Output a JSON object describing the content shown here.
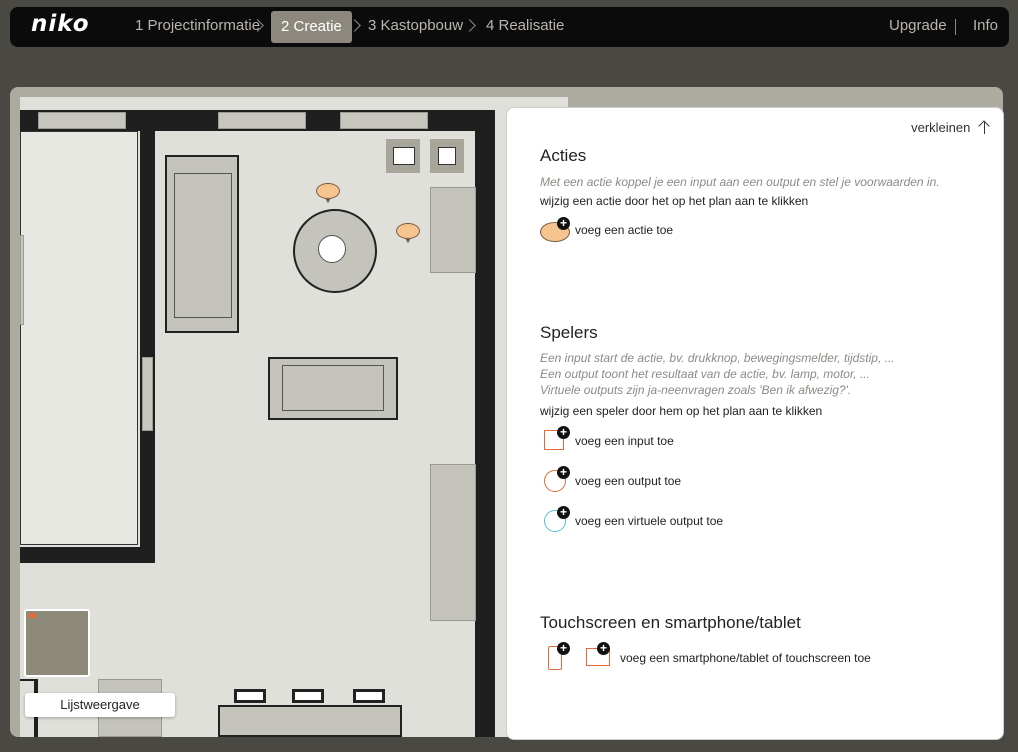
{
  "brand": {
    "logo": "niko"
  },
  "nav": {
    "steps": [
      {
        "label": "1 Projectinformatie",
        "active": false
      },
      {
        "label": "2 Creatie",
        "active": true
      },
      {
        "label": "3 Kastopbouw",
        "active": false
      },
      {
        "label": "4 Realisatie",
        "active": false
      }
    ],
    "upgrade": "Upgrade",
    "info": "Info"
  },
  "plan": {
    "list_view_button": "Lijstweergave"
  },
  "panel": {
    "collapse_label": "verkleinen",
    "acties": {
      "title": "Acties",
      "hint": "Met een actie koppel je een input aan een output en stel je voorwaarden in.",
      "note": "wijzig een actie door het op het plan aan te klikken",
      "add_label": "voeg een actie toe"
    },
    "spelers": {
      "title": "Spelers",
      "hint_lines": [
        "Een input start de actie, bv. drukknop, bewegingsmelder, tijdstip, ...",
        "Een output toont het resultaat van de actie, bv. lamp, motor, ...",
        "Virtuele outputs zijn ja-neenvragen zoals 'Ben ik afwezig?'."
      ],
      "note": "wijzig een speler door hem op het plan aan te klikken",
      "add_input": "voeg een input toe",
      "add_output": "voeg een output toe",
      "add_virtual": "voeg een virtuele output toe"
    },
    "touchscreen": {
      "title": "Touchscreen en smartphone/tablet",
      "add_label": "voeg een smartphone/tablet of touchscreen toe"
    }
  },
  "colors": {
    "accent": "#e06a3a",
    "action": "#f5c48f",
    "virtual": "#5bc0d8"
  }
}
